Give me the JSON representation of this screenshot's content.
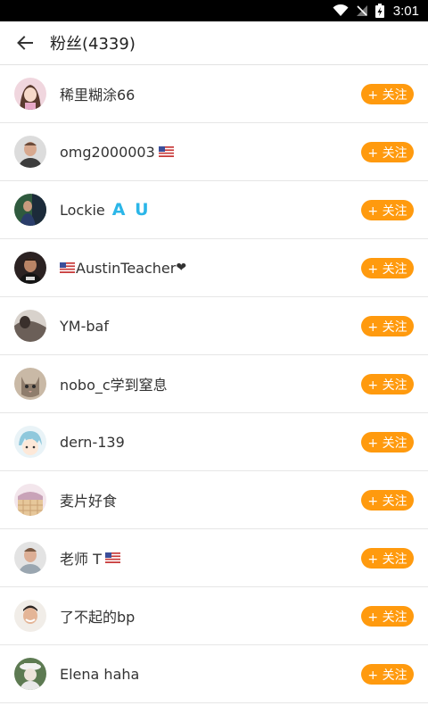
{
  "status_bar": {
    "time": "3:01"
  },
  "header": {
    "title": "粉丝(4339)"
  },
  "follow_label": "+ 关注",
  "fans": [
    {
      "name": "稀里糊涂66"
    },
    {
      "name": "omg2000003"
    },
    {
      "name": "Lockie"
    },
    {
      "name": "AustinTeacher"
    },
    {
      "name": "YM-baf"
    },
    {
      "name": "nobo_c学到窒息"
    },
    {
      "name": "dern-139"
    },
    {
      "name": "麦片好食"
    },
    {
      "name": "老师 T"
    },
    {
      "name": "了不起的bp"
    },
    {
      "name": "Elena haha"
    }
  ],
  "decor": {
    "au_text": "A U",
    "heart": "❤"
  },
  "colors": {
    "accent": "#ff9a0e",
    "au": "#2bb6e8"
  }
}
